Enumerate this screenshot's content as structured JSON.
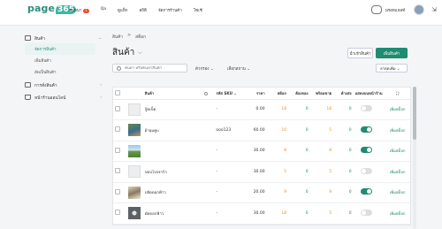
{
  "topbar": {
    "logo_text": "page",
    "logo_badge": "365",
    "nav": [
      {
        "label": "สนทนา",
        "badge": "1"
      },
      {
        "label": "Qa"
      },
      {
        "label": "ดูแท็ก"
      },
      {
        "label": "สถิติ"
      },
      {
        "label": "จัดการร้านค้า"
      },
      {
        "label": "โซเชี"
      }
    ],
    "shop_name": "นรอทแจลท์",
    "expand_glyph": "⇲"
  },
  "sidebar": {
    "groups": [
      {
        "label": "สินค้า",
        "icon": "box-icon",
        "chevron": "⌄",
        "items": [
          {
            "label": "จัดการสินค้า",
            "active": true
          },
          {
            "label": "เพิ่มสินค้า",
            "active": false
          },
          {
            "label": "อัพเป็นสินค้า",
            "active": false
          }
        ]
      },
      {
        "label": "การสั่งสินค้า",
        "icon": "order-icon",
        "chevron": "›"
      },
      {
        "label": "หน้าร้านออนไลน์",
        "icon": "cart-icon",
        "chevron": "›"
      }
    ]
  },
  "main": {
    "breadcrumb": [
      "สินค้า",
      ">",
      "สต็อก"
    ],
    "title": "สินค้า",
    "title_dropdown": "⌵",
    "export_label": "นำเข้าสินค้า",
    "add_label": "เพิ่มสินค้า",
    "search_placeholder": "ค้นหา หรือค้นหาสินค้า",
    "filter1": "ตัวกรอง ⌄",
    "filter2": "เลือกสถาน ⌄",
    "sort_label": "ล่าสุดเพิ่ม ⌄",
    "columns": [
      "",
      "",
      "สินค้า",
      "",
      "รหัส SKU ⌄",
      "ราคา",
      "สต็อก",
      "ต้องจอง",
      "พร้อมขาย",
      "ค้างส่ง",
      "แสดงบนหน้าร้าน",
      "⛶"
    ],
    "rows": [
      {
        "name": "กู้คเข็ต",
        "sku": "-",
        "price": "0.00",
        "stock": "18",
        "reserved": "0",
        "available": "18",
        "pending": "0",
        "show": false,
        "image": "placeholder",
        "action": "เพิ่มสต็อก"
      },
      {
        "name": "ผ้าลุมคูบ",
        "sku": "ooo123",
        "price": "60.00",
        "stock": "10",
        "reserved": "0",
        "available": "5",
        "pending": "0",
        "show": true,
        "image": "photo-portrait",
        "action": "เพิ่มสต็อก"
      },
      {
        "name": "",
        "sku": "-",
        "price": "30.00",
        "stock": "8",
        "reserved": "0",
        "available": "8",
        "pending": "0",
        "show": true,
        "image": "photo-landscape",
        "action": "เพิ่มสต็อก"
      },
      {
        "name": "ขอบไรอจาร์ว",
        "sku": "-",
        "price": "30.00",
        "stock": "5",
        "reserved": "0",
        "available": "5",
        "pending": "0",
        "show": false,
        "image": "placeholder",
        "action": "เพิ่มสต็อก"
      },
      {
        "name": "ปลัดดอกฟ้าว",
        "sku": "-",
        "price": "20.00",
        "stock": "9",
        "reserved": "0",
        "available": "9",
        "pending": "0",
        "show": true,
        "image": "photo-food",
        "action": "เพิ่มสต็อก"
      },
      {
        "name": "มัดดอกฟ้าว",
        "sku": "-",
        "price": "30.00",
        "stock": "18",
        "reserved": "0",
        "available": "5",
        "pending": "0",
        "show": false,
        "image": "photo-dark",
        "action": "เพิ่มสต็อก"
      }
    ]
  },
  "colors": {
    "accent": "#1f8b71",
    "orange": "#f08a24",
    "badge": "#e94b3c"
  }
}
